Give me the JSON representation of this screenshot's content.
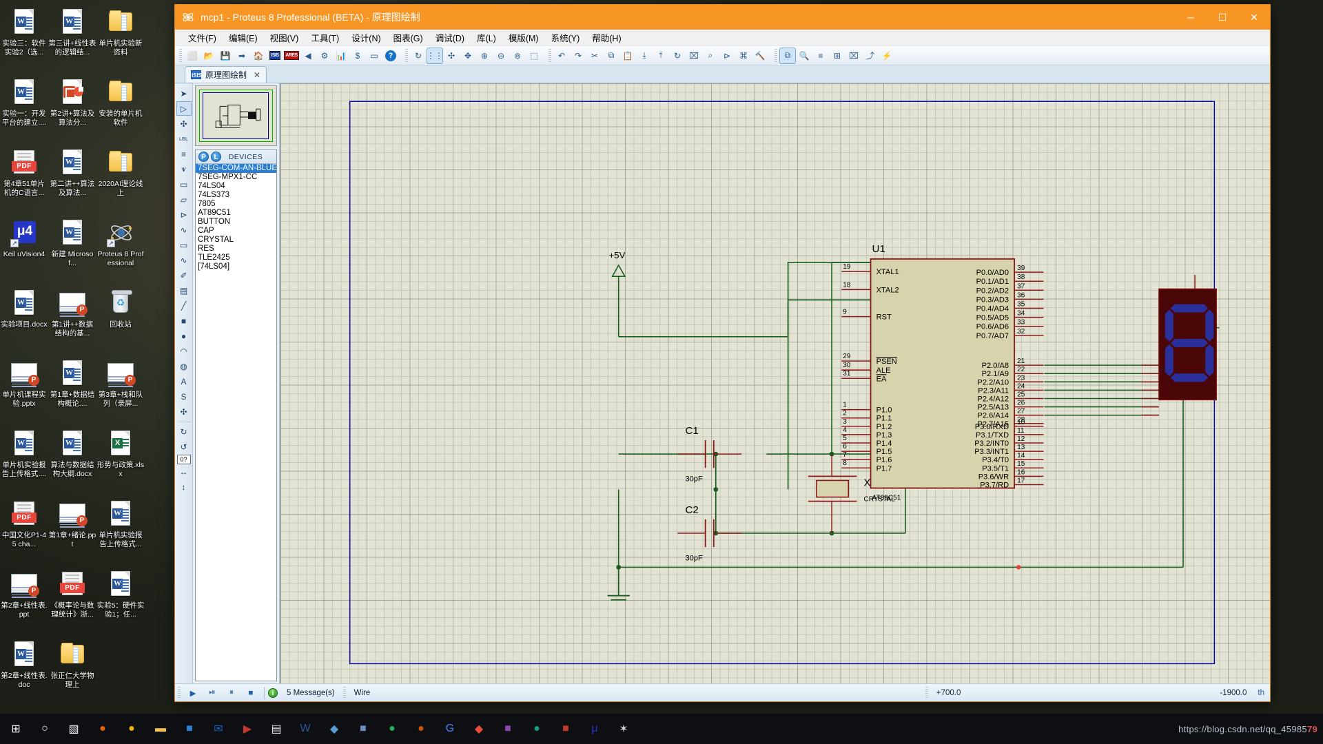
{
  "window": {
    "title": "mcp1 - Proteus 8 Professional (BETA) - 原理图绘制",
    "minimize": "─",
    "maximize": "☐",
    "close": "✕"
  },
  "menu": [
    {
      "label": "文件(F)"
    },
    {
      "label": "编辑(E)"
    },
    {
      "label": "视图(V)"
    },
    {
      "label": "工具(T)"
    },
    {
      "label": "设计(N)"
    },
    {
      "label": "图表(G)"
    },
    {
      "label": "调试(D)"
    },
    {
      "label": "库(L)"
    },
    {
      "label": "模版(M)"
    },
    {
      "label": "系统(Y)"
    },
    {
      "label": "帮助(H)"
    }
  ],
  "toolbar": {
    "group1": [
      {
        "name": "new-file-icon",
        "glyph": "⬜"
      },
      {
        "name": "open-file-icon",
        "glyph": "📂"
      },
      {
        "name": "save-file-icon",
        "glyph": "💾"
      },
      {
        "name": "export-icon",
        "glyph": "➡"
      },
      {
        "name": "home-icon",
        "glyph": "🏠"
      },
      {
        "name": "isis-icon",
        "glyph": "ISIS"
      },
      {
        "name": "ares-icon",
        "glyph": "ARES"
      },
      {
        "name": "3d-view-icon",
        "glyph": "◀"
      },
      {
        "name": "gerber-icon",
        "glyph": "⚙"
      },
      {
        "name": "bom-icon",
        "glyph": "📊"
      },
      {
        "name": "bill-icon",
        "glyph": "$"
      },
      {
        "name": "cad-icon",
        "glyph": "▭"
      },
      {
        "name": "help-icon",
        "glyph": "?"
      }
    ],
    "group2": [
      {
        "name": "refresh-icon",
        "glyph": "↻"
      },
      {
        "name": "grid-toggle-icon",
        "glyph": "⋮⋮"
      },
      {
        "name": "origin-icon",
        "glyph": "✣"
      },
      {
        "name": "pan-icon",
        "glyph": "✥"
      },
      {
        "name": "zoom-in-icon",
        "glyph": "⊕"
      },
      {
        "name": "zoom-out-icon",
        "glyph": "⊖"
      },
      {
        "name": "zoom-fit-icon",
        "glyph": "⊚"
      },
      {
        "name": "zoom-area-icon",
        "glyph": "⬚"
      }
    ],
    "group3": [
      {
        "name": "undo-icon",
        "glyph": "↶"
      },
      {
        "name": "redo-icon",
        "glyph": "↷"
      },
      {
        "name": "cut-icon",
        "glyph": "✂"
      },
      {
        "name": "copy-icon",
        "glyph": "⧉"
      },
      {
        "name": "paste-icon",
        "glyph": "📋"
      },
      {
        "name": "block-copy-icon",
        "glyph": "⤓"
      },
      {
        "name": "block-move-icon",
        "glyph": "⤒"
      },
      {
        "name": "block-rotate-icon",
        "glyph": "↻"
      },
      {
        "name": "block-delete-icon",
        "glyph": "⌧"
      },
      {
        "name": "pick-device-icon",
        "glyph": "⌕"
      },
      {
        "name": "make-device-icon",
        "glyph": "⊳"
      },
      {
        "name": "packaging-tool-icon",
        "glyph": "⌘"
      },
      {
        "name": "decompose-icon",
        "glyph": "🔨"
      }
    ],
    "group4": [
      {
        "name": "wire-autorouter-icon",
        "glyph": "⧉"
      },
      {
        "name": "search-tag-icon",
        "glyph": "🔍"
      },
      {
        "name": "property-assign-icon",
        "glyph": "≡"
      },
      {
        "name": "new-sheet-icon",
        "glyph": "⊞"
      },
      {
        "name": "remove-sheet-icon",
        "glyph": "⌧"
      },
      {
        "name": "exit-sheet-icon",
        "glyph": "⤴"
      },
      {
        "name": "bill-of-materials-icon",
        "glyph": "⚡"
      }
    ]
  },
  "tab": {
    "icon_text": "ISIS",
    "label": "原理图绘制",
    "close": "✕"
  },
  "left_toolbar": [
    {
      "name": "selection-mode-tool",
      "glyph": "➤",
      "selected": false
    },
    {
      "name": "component-mode-tool",
      "glyph": "▷",
      "selected": true
    },
    {
      "name": "junction-dot-tool",
      "glyph": "✣",
      "selected": false
    },
    {
      "name": "wire-label-tool",
      "glyph": "LBL",
      "selected": false
    },
    {
      "name": "text-script-tool",
      "glyph": "≡",
      "selected": false
    },
    {
      "name": "bus-tool",
      "glyph": "⩛",
      "selected": false
    },
    {
      "name": "subcircuit-tool",
      "glyph": "▭",
      "selected": false
    },
    {
      "name": "terminal-mode-tool",
      "glyph": "▱",
      "selected": false
    },
    {
      "name": "device-pin-tool",
      "glyph": "⊳",
      "selected": false
    },
    {
      "name": "graph-mode-tool",
      "glyph": "∿",
      "selected": false
    },
    {
      "name": "tape-recorder-tool",
      "glyph": "▭",
      "selected": false
    },
    {
      "name": "generator-mode-tool",
      "glyph": "∿",
      "selected": false
    },
    {
      "name": "voltage-probe-tool",
      "glyph": "✐",
      "selected": false
    },
    {
      "name": "virtual-instrument-tool",
      "glyph": "▤",
      "selected": false
    },
    {
      "name": "line-tool",
      "glyph": "╱",
      "selected": false
    },
    {
      "name": "box-tool",
      "glyph": "■",
      "selected": false
    },
    {
      "name": "circle-tool",
      "glyph": "●",
      "selected": false
    },
    {
      "name": "arc-tool",
      "glyph": "◠",
      "selected": false
    },
    {
      "name": "path-tool",
      "glyph": "◍",
      "selected": false
    },
    {
      "name": "text-tool",
      "glyph": "A",
      "selected": false
    },
    {
      "name": "symbol-tool",
      "glyph": "S",
      "selected": false
    },
    {
      "name": "marker-tool",
      "glyph": "✣",
      "selected": false
    },
    {
      "name": "rotate-cw-tool",
      "glyph": "↻",
      "selected": false
    },
    {
      "name": "rotate-ccw-tool",
      "glyph": "↺",
      "selected": false
    },
    {
      "name": "rotation-value-box",
      "glyph": "0?",
      "selected": false
    },
    {
      "name": "mirror-x-tool",
      "glyph": "↔",
      "selected": false
    },
    {
      "name": "mirror-y-tool",
      "glyph": "↕",
      "selected": false
    }
  ],
  "devices_panel": {
    "p_button": "P",
    "l_button": "L",
    "title": "DEVICES",
    "items": [
      {
        "label": "7SEG-COM-AN-BLUE",
        "selected": true
      },
      {
        "label": "7SEG-MPX1-CC",
        "selected": false
      },
      {
        "label": "74LS04",
        "selected": false
      },
      {
        "label": "74LS373",
        "selected": false
      },
      {
        "label": "7805",
        "selected": false
      },
      {
        "label": "AT89C51",
        "selected": false
      },
      {
        "label": "BUTTON",
        "selected": false
      },
      {
        "label": "CAP",
        "selected": false
      },
      {
        "label": "CRYSTAL",
        "selected": false
      },
      {
        "label": "RES",
        "selected": false
      },
      {
        "label": "TLE2425",
        "selected": false
      },
      {
        "label": "[74LS04]",
        "selected": false
      }
    ]
  },
  "schematic": {
    "power_label": "+5V",
    "u1": {
      "ref": "U1",
      "part": "AT89C51",
      "left_pins": [
        {
          "num": "19",
          "name": "XTAL1"
        },
        {
          "num": "18",
          "name": "XTAL2"
        },
        {
          "num": "9",
          "name": "RST"
        },
        {
          "num": "29",
          "name": "PSEN"
        },
        {
          "num": "30",
          "name": "ALE"
        },
        {
          "num": "31",
          "name": "EA"
        },
        {
          "num": "1",
          "name": "P1.0"
        },
        {
          "num": "2",
          "name": "P1.1"
        },
        {
          "num": "3",
          "name": "P1.2"
        },
        {
          "num": "4",
          "name": "P1.3"
        },
        {
          "num": "5",
          "name": "P1.4"
        },
        {
          "num": "6",
          "name": "P1.5"
        },
        {
          "num": "7",
          "name": "P1.6"
        },
        {
          "num": "8",
          "name": "P1.7"
        }
      ],
      "right_pins_p0": [
        {
          "num": "39",
          "name": "P0.0/AD0"
        },
        {
          "num": "38",
          "name": "P0.1/AD1"
        },
        {
          "num": "37",
          "name": "P0.2/AD2"
        },
        {
          "num": "36",
          "name": "P0.3/AD3"
        },
        {
          "num": "35",
          "name": "P0.4/AD4"
        },
        {
          "num": "34",
          "name": "P0.5/AD5"
        },
        {
          "num": "33",
          "name": "P0.6/AD6"
        },
        {
          "num": "32",
          "name": "P0.7/AD7"
        }
      ],
      "right_pins_p2": [
        {
          "num": "21",
          "name": "P2.0/A8"
        },
        {
          "num": "22",
          "name": "P2.1/A9"
        },
        {
          "num": "23",
          "name": "P2.2/A10"
        },
        {
          "num": "24",
          "name": "P2.3/A11"
        },
        {
          "num": "25",
          "name": "P2.4/A12"
        },
        {
          "num": "26",
          "name": "P2.5/A13"
        },
        {
          "num": "27",
          "name": "P2.6/A14"
        },
        {
          "num": "28",
          "name": "P2.7/A15"
        }
      ],
      "right_pins_p3": [
        {
          "num": "10",
          "name": "P3.0/RXD"
        },
        {
          "num": "11",
          "name": "P3.1/TXD"
        },
        {
          "num": "12",
          "name": "P3.2/INT0"
        },
        {
          "num": "13",
          "name": "P3.3/INT1"
        },
        {
          "num": "14",
          "name": "P3.4/T0"
        },
        {
          "num": "15",
          "name": "P3.5/T1"
        },
        {
          "num": "16",
          "name": "P3.6/WR"
        },
        {
          "num": "17",
          "name": "P3.7/RD"
        }
      ]
    },
    "c1": {
      "ref": "C1",
      "value": "30pF"
    },
    "c2": {
      "ref": "C2",
      "value": "30pF"
    },
    "x1": {
      "ref": "X1",
      "value": "CRYSTAL"
    },
    "colors": {
      "body_fill": "#d7d3ac",
      "body_stroke": "#8b1a1a",
      "wire_green": "#1b5e20",
      "pin_red": "#8b1a1a",
      "seven_seg_body": "#4a0606",
      "seven_seg_segment": "#2b2f99",
      "sheet_border": "#0000b0",
      "canvas_bg": "#e2e3d2"
    }
  },
  "statusbar": {
    "run": "▶",
    "step": "⏯",
    "pause": "⏸",
    "stop": "■",
    "messages": "5 Message(s)",
    "mode": "Wire",
    "coord_x": "+700.0",
    "coord_y": "-1900.0",
    "unit": "th"
  },
  "desktop_icons": [
    {
      "name": "word-doc",
      "type": "word",
      "label": "实验三：软件实验2（选..."
    },
    {
      "name": "word-doc",
      "type": "word",
      "label": "第三讲+线性表的逻辑结..."
    },
    {
      "name": "folder",
      "type": "folder",
      "label": "单片机实验新资料"
    },
    {
      "name": "word-doc",
      "type": "word",
      "label": "实验一：开发平台的建立...."
    },
    {
      "name": "ppt-doc",
      "type": "ppt",
      "label": "第2讲+算法及算法分..."
    },
    {
      "name": "folder",
      "type": "folder",
      "label": "安装的单片机软件"
    },
    {
      "name": "pdf-doc",
      "type": "pdf",
      "label": "第4章51单片机的C语言..."
    },
    {
      "name": "word-doc",
      "type": "word",
      "label": "第二讲++算法及算法..."
    },
    {
      "name": "folder-open",
      "type": "folderw",
      "label": "2020AI理论线上"
    },
    {
      "name": "keil-app",
      "type": "keil",
      "label": "Keil uVision4"
    },
    {
      "name": "word-doc",
      "type": "word",
      "label": "新建 Microsof..."
    },
    {
      "name": "proteus-app",
      "type": "atom",
      "label": "Proteus 8 Professional"
    },
    {
      "name": "word-doc",
      "type": "word",
      "label": "实验项目.docx"
    },
    {
      "name": "ppt-slide",
      "type": "slide",
      "label": "第1讲++数据结构的基..."
    },
    {
      "name": "recycle-bin",
      "type": "bin",
      "label": "回收站"
    },
    {
      "name": "ppt-slide",
      "type": "slide",
      "label": "单片机课程实验.pptx"
    },
    {
      "name": "word-doc",
      "type": "word",
      "label": "第1章+数据结构概论...."
    },
    {
      "name": "ppt-slide",
      "type": "slide",
      "label": "第3章+栈和队列（录屏..."
    },
    {
      "name": "word-doc",
      "type": "word",
      "label": "单片机实验报告上传格式...."
    },
    {
      "name": "word-doc",
      "type": "word",
      "label": "算法与数据结构大纲.docx"
    },
    {
      "name": "excel-doc",
      "type": "excel",
      "label": "形势与政策.xlsx"
    },
    {
      "name": "pdf-doc",
      "type": "pdf",
      "label": "中国文化P1-45 cha..."
    },
    {
      "name": "ppt-slide",
      "type": "slide",
      "label": "第1章+绪论.ppt"
    },
    {
      "name": "word-doc",
      "type": "word",
      "label": "单片机实验报告上传格式..."
    },
    {
      "name": "ppt-slide",
      "type": "slide",
      "label": "第2章+线性表.ppt"
    },
    {
      "name": "pdf-doc",
      "type": "pdf",
      "label": "《概率论与数理统计》浙..."
    },
    {
      "name": "word-doc",
      "type": "word",
      "label": "实验5：硬件实验1；任..."
    },
    {
      "name": "word-doc",
      "type": "word",
      "label": "第2章+线性表.doc"
    },
    {
      "name": "folder",
      "type": "folder",
      "label": "张正仁大学物理上"
    }
  ],
  "taskbar": {
    "items": [
      {
        "name": "start-button",
        "glyph": "⊞",
        "color": "#ffffff"
      },
      {
        "name": "search-icon",
        "glyph": "○",
        "color": "#ffffff"
      },
      {
        "name": "task-view-icon",
        "glyph": "▧",
        "color": "#ffffff"
      },
      {
        "name": "firefox-icon",
        "glyph": "●",
        "color": "#e66000"
      },
      {
        "name": "chrome-icon",
        "glyph": "●",
        "color": "#f4b400"
      },
      {
        "name": "file-explorer-icon",
        "glyph": "▬",
        "color": "#f5c34a"
      },
      {
        "name": "store-icon",
        "glyph": "■",
        "color": "#2b7fd4"
      },
      {
        "name": "mail-icon",
        "glyph": "✉",
        "color": "#1664c0"
      },
      {
        "name": "media-icon",
        "glyph": "▶",
        "color": "#c23a2b"
      },
      {
        "name": "notepad-icon",
        "glyph": "▤",
        "color": "#e8e8e8"
      },
      {
        "name": "word-icon",
        "glyph": "W",
        "color": "#2b579a"
      },
      {
        "name": "app-icon-1",
        "glyph": "◆",
        "color": "#5a9bd5"
      },
      {
        "name": "app-icon-2",
        "glyph": "■",
        "color": "#6c8ebf"
      },
      {
        "name": "app-icon-3",
        "glyph": "●",
        "color": "#27ae60"
      },
      {
        "name": "app-icon-4",
        "glyph": "●",
        "color": "#d35400"
      },
      {
        "name": "google-icon",
        "glyph": "G",
        "color": "#4285f4"
      },
      {
        "name": "app-icon-5",
        "glyph": "◆",
        "color": "#e74c3c"
      },
      {
        "name": "app-icon-6",
        "glyph": "■",
        "color": "#8e44ad"
      },
      {
        "name": "app-icon-7",
        "glyph": "●",
        "color": "#16a085"
      },
      {
        "name": "app-icon-8",
        "glyph": "■",
        "color": "#c0392b"
      },
      {
        "name": "keil-task-icon",
        "glyph": "μ",
        "color": "#2536c8"
      },
      {
        "name": "proteus-task-icon",
        "glyph": "✶",
        "color": "#cfd8e3"
      }
    ],
    "watermark_prefix": "https://blog.csdn.net/qq_45985",
    "watermark_badge": "79"
  }
}
